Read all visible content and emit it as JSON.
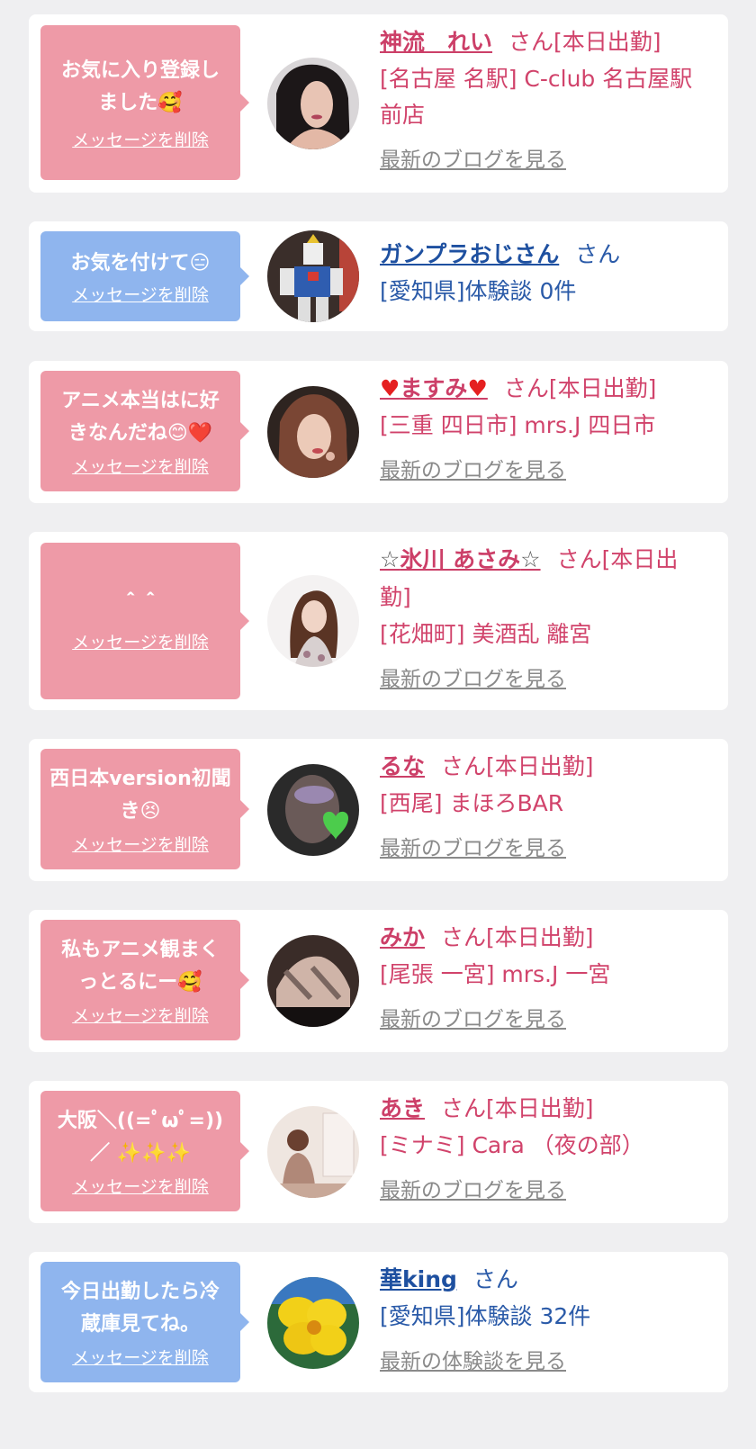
{
  "delete_label": "メッセージを削除",
  "cards": [
    {
      "message_lines": [
        "お気に入り登録し",
        "ました"
      ],
      "message_emoji": "🥰",
      "name": "神流　れい",
      "suffix": "さん[本日出勤]",
      "shop": "[名古屋 名駅] C-club 名古屋駅前店",
      "link": "最新のブログを見る",
      "bubble_color": "pink"
    },
    {
      "message_lines": [
        "お気を付けて"
      ],
      "message_emoji": "😑",
      "name": "ガンプラおじさん",
      "suffix": "さん",
      "shop": "[愛知県]体験談 0件",
      "link": "",
      "bubble_color": "blue"
    },
    {
      "message_lines": [
        "アニメ本当はに好",
        "きなんだね"
      ],
      "message_emoji": "😊❤️",
      "name": "ますみ",
      "name_decoration": "heart",
      "suffix": "さん[本日出勤]",
      "shop": "[三重 四日市] mrs.J 四日市",
      "link": "最新のブログを見る",
      "bubble_color": "pink"
    },
    {
      "message_lines": [
        "＾＾"
      ],
      "message_emoji": "",
      "name": "氷川 あさみ",
      "name_decoration": "star",
      "suffix": "さん[本日出勤]",
      "shop": "[花畑町] 美酒乱 離宮",
      "link": "最新のブログを見る",
      "bubble_color": "pink"
    },
    {
      "message_lines": [
        "西日本version初聞",
        "き"
      ],
      "message_emoji": "😣",
      "name": "るな",
      "suffix": "さん[本日出勤]",
      "shop": "[西尾] まほろBAR",
      "link": "最新のブログを見る",
      "bubble_color": "pink"
    },
    {
      "message_lines": [
        "私もアニメ観まく",
        "っとるにー"
      ],
      "message_emoji": "🥰",
      "name": "みか",
      "suffix": "さん[本日出勤]",
      "shop": "[尾張 一宮] mrs.J 一宮",
      "link": "最新のブログを見る",
      "bubble_color": "pink"
    },
    {
      "message_lines": [
        "大阪＼((=ﾟωﾟ=))",
        "／ ✨✨✨"
      ],
      "message_emoji": "",
      "name": "あき",
      "suffix": "さん[本日出勤]",
      "shop": "[ミナミ] Cara （夜の部）",
      "link": "最新のブログを見る",
      "bubble_color": "pink"
    },
    {
      "message_lines": [
        "今日出勤したら冷",
        "蔵庫見てね。"
      ],
      "message_emoji": "",
      "name": "華king",
      "suffix": "さん",
      "shop": "[愛知県]体験談 32件",
      "link": "最新の体験談を見る",
      "bubble_color": "blue"
    }
  ],
  "colors": {
    "page_bg": "#efeff1",
    "bubble_pink": "#ee9aa7",
    "bubble_blue": "#8fb5ee",
    "name_red": "#d1436b",
    "name_navy": "#2a5aa8",
    "link_gray": "#8a8a8a"
  },
  "avatars": [
    "woman-portrait-avatar",
    "gundam-model-avatar",
    "woman-portrait-avatar",
    "woman-portrait-avatar",
    "masked-face-avatar",
    "legs-photo-avatar",
    "room-mirror-avatar",
    "yellow-hibiscus-avatar"
  ]
}
